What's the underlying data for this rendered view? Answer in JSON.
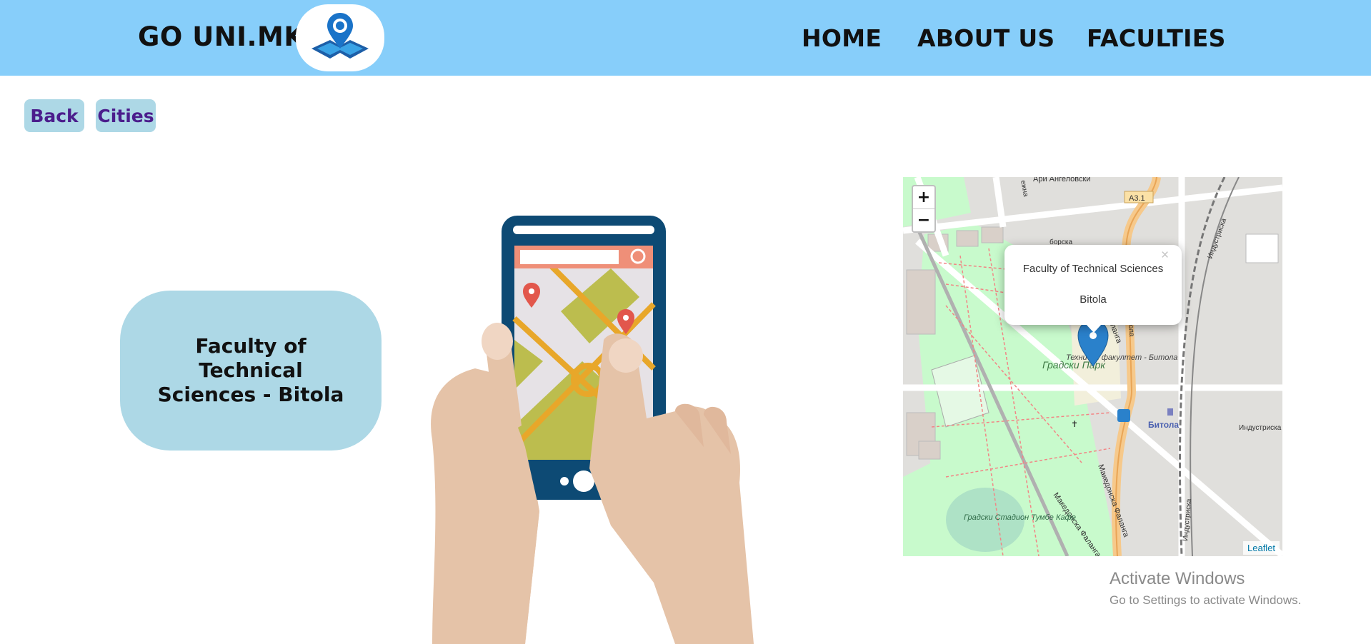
{
  "header": {
    "brand": "GO UNI.MK",
    "logo_icon": "map-pin-logo-icon",
    "nav": [
      {
        "label": "HOME"
      },
      {
        "label": "ABOUT US"
      },
      {
        "label": "FACULTIES"
      }
    ]
  },
  "breadcrumbs": {
    "back": "Back",
    "cities": "Cities"
  },
  "faculty": {
    "title": "Faculty of Technical Sciences - Bitola"
  },
  "map": {
    "zoom_in": "+",
    "zoom_out": "−",
    "popup_line1": "Faculty of Technical Sciences",
    "popup_line2": "Bitola",
    "popup_close": "×",
    "attribution": "Leaflet",
    "labels": {
      "ari": "Ари Ангеловски",
      "a31": "А3.1",
      "borska": "борска",
      "industriska_v": "Индустриска",
      "industriska_h": "Индустриска",
      "industriska_v2": "Индустриска",
      "park": "Градски Парк",
      "faculty_local": "Технички факултет - Битола",
      "bitola": "Битола",
      "falanga1": "Македонска Фаланга",
      "falanga2": "Македонска Фаланга",
      "falanga3": "Фаланга",
      "stadium": "Градски Стадион Тумбе Кафе",
      "street_vert": "ежна",
      "ola": "ола"
    },
    "colors": {
      "marker": "#2a81cb",
      "park": "#c8facc",
      "road": "#f6c98b"
    }
  },
  "os_watermark": {
    "title": "Activate Windows",
    "subtitle": "Go to Settings to activate Windows."
  }
}
